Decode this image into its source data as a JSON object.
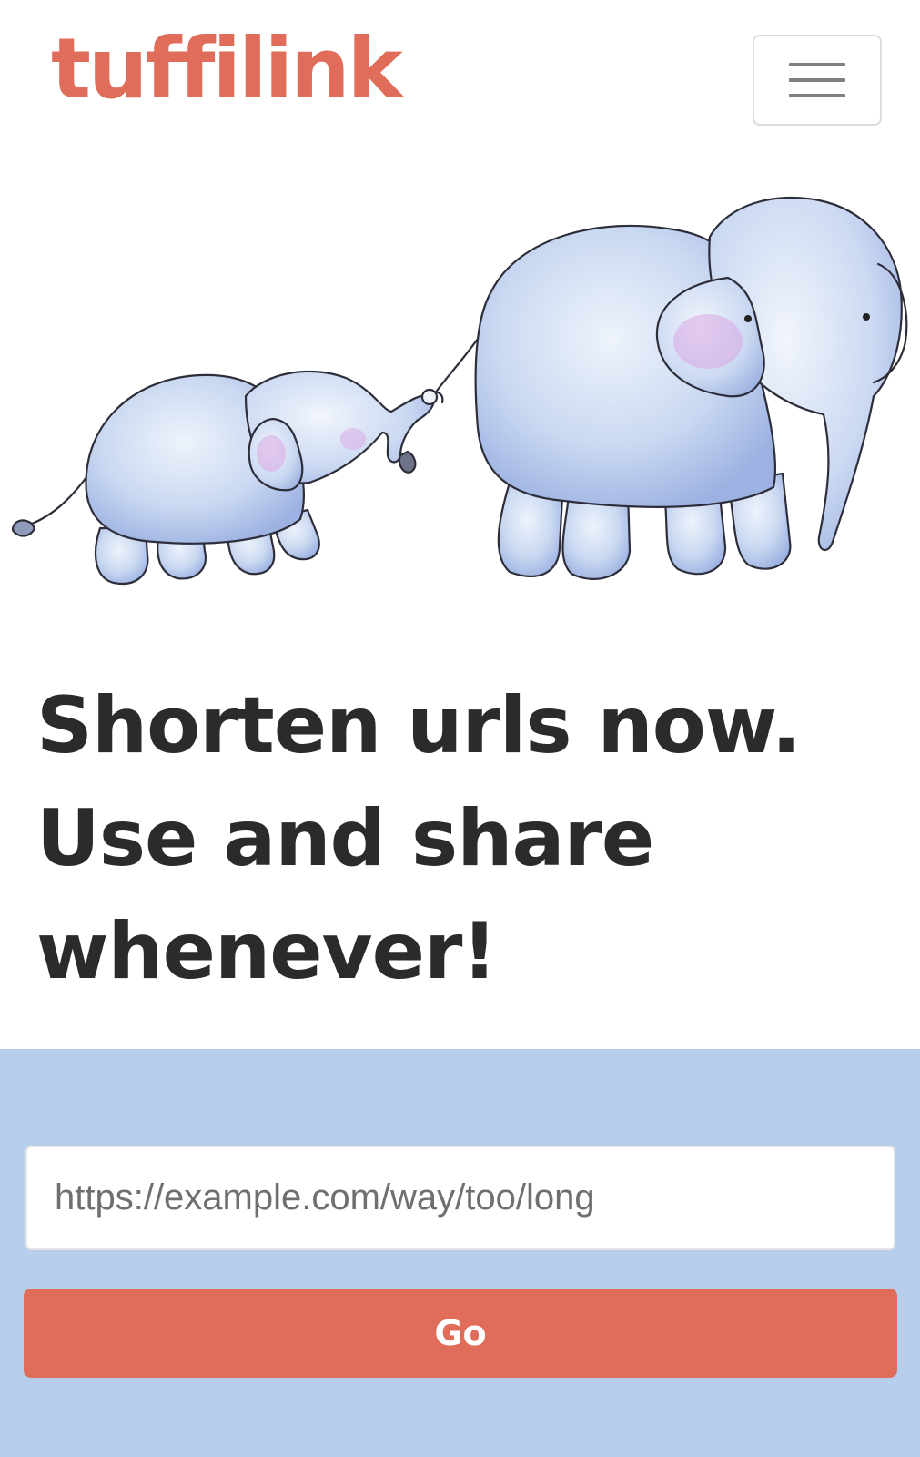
{
  "navbar": {
    "brand": "tuffilink",
    "menu_toggle_icon": "hamburger-menu-icon"
  },
  "hero": {
    "image": "elephant-mother-and-calf-illustration"
  },
  "headline": {
    "line1": "Shorten urls now.",
    "line2": "Use and share",
    "line3": "whenever!"
  },
  "form": {
    "url_placeholder": "https://example.com/way/too/long",
    "url_value": "",
    "submit_label": "Go"
  },
  "colors": {
    "brand": "#e06c5a",
    "headline": "#2b2b2b",
    "form_background": "#b7ceec",
    "button": "#e06c5a",
    "button_text": "#ffffff"
  }
}
